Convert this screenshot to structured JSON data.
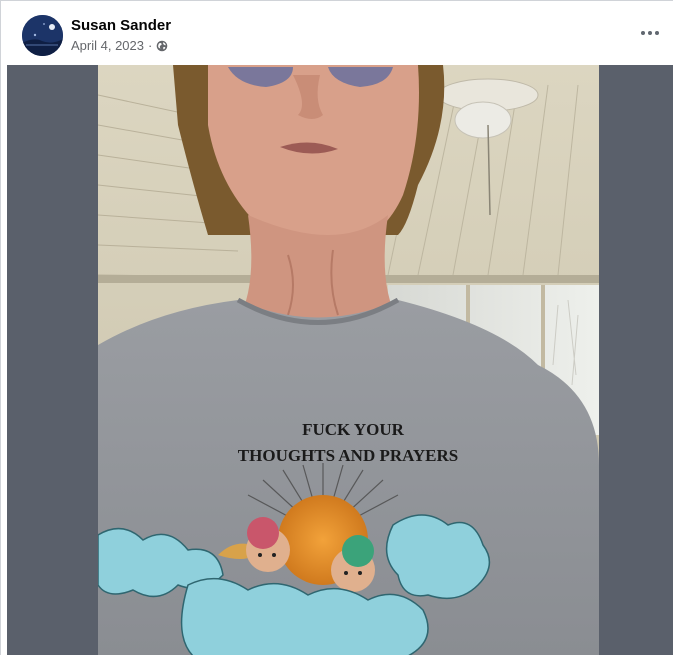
{
  "post": {
    "author": "Susan Sander",
    "date": "April 4, 2023",
    "separator": "·",
    "privacy_icon": "globe-icon",
    "more_icon": "more-options-icon"
  },
  "photo": {
    "shirt_text_line1": "FUCK YOUR",
    "shirt_text_line2": "THOUGHTS AND PRAYERS"
  },
  "colors": {
    "name": "#050505",
    "meta": "#65676b",
    "media_backdrop": "#5a606b",
    "shirt": "#8e9196"
  }
}
